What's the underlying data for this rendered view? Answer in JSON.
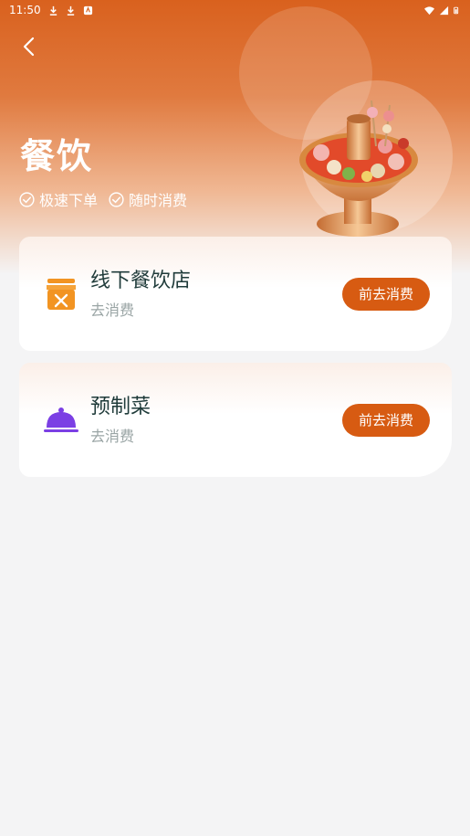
{
  "status_bar": {
    "time": "11:50",
    "icons_left": [
      "download-icon",
      "download-icon",
      "app-notification-icon"
    ],
    "icons_right": [
      "wifi-icon",
      "signal-icon",
      "battery-icon"
    ]
  },
  "header": {
    "back_icon": "chevron-left-icon",
    "title": "餐饮",
    "features": [
      {
        "icon": "check-circle-icon",
        "label": "极速下单"
      },
      {
        "icon": "check-circle-icon",
        "label": "随时消费"
      }
    ]
  },
  "cards": [
    {
      "icon": "store-icon",
      "title": "线下餐饮店",
      "subtitle": "去消费",
      "button": "前去消费",
      "icon_color": "#f29422"
    },
    {
      "icon": "food-cloche-icon",
      "title": "预制菜",
      "subtitle": "去消费",
      "button": "前去消费",
      "icon_color": "#7b3fe4"
    }
  ],
  "colors": {
    "accent": "#d75b12",
    "header_top": "#d9611e",
    "background": "#f4f4f5"
  }
}
